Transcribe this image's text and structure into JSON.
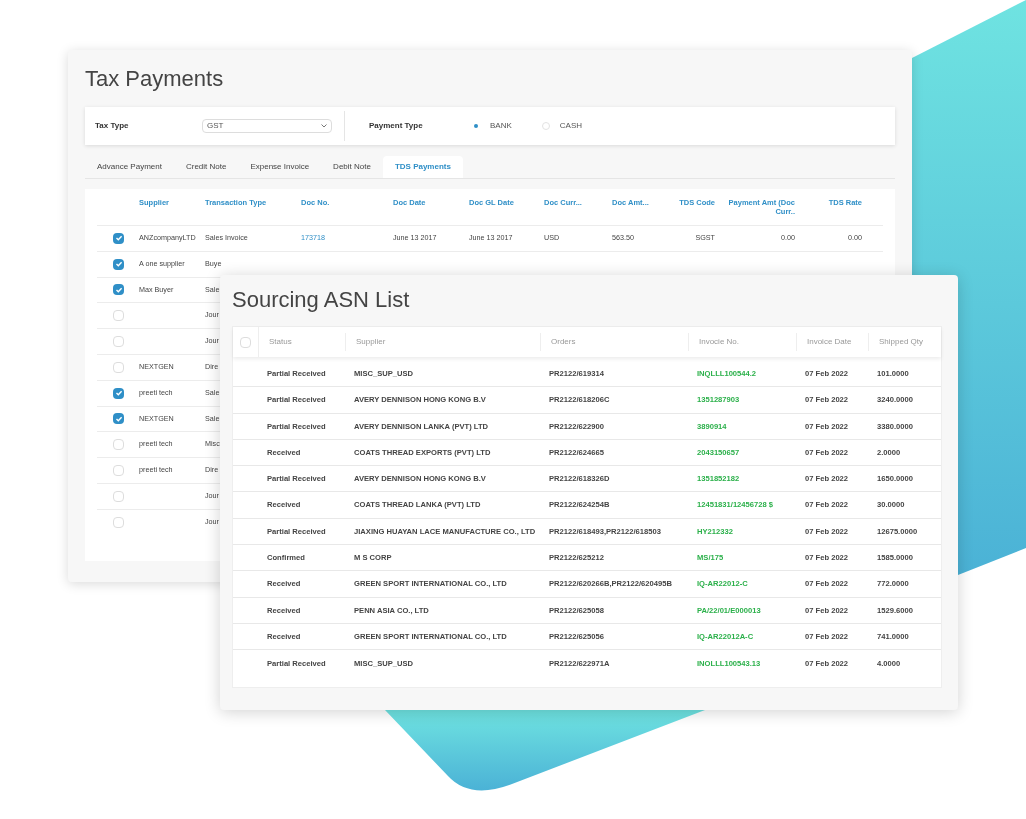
{
  "tax_payments": {
    "title": "Tax Payments",
    "tax_type": {
      "label": "Tax Type",
      "value": "GST"
    },
    "payment_type": {
      "label": "Payment Type",
      "options": [
        {
          "label": "BANK",
          "selected": true
        },
        {
          "label": "CASH",
          "selected": false
        }
      ]
    },
    "tabs": [
      {
        "label": "Advance Payment",
        "selected": false
      },
      {
        "label": "Credit Note",
        "selected": false
      },
      {
        "label": "Expense Invoice",
        "selected": false
      },
      {
        "label": "Debit Note",
        "selected": false
      },
      {
        "label": "TDS Payments",
        "selected": true
      }
    ],
    "table": {
      "columns": [
        "Supplier",
        "Transaction Type",
        "Doc No.",
        "Doc Date",
        "Doc GL Date",
        "Doc Curr...",
        "Doc Amt...",
        "TDS Code",
        "Payment Amt (Doc Curr..",
        "TDS Rate"
      ],
      "rows": [
        {
          "checked": true,
          "supplier": "ANZcompanyLTD",
          "transaction_type": "Sales Invoice",
          "doc_no": "173718",
          "doc_date": "June 13 2017",
          "doc_gl_date": "June 13 2017",
          "doc_currency": "USD",
          "doc_amount": "563.50",
          "tds_code": "SGST",
          "payment_amount": "0.00",
          "tds_rate": "0.00"
        },
        {
          "checked": true,
          "supplier": "A one supplier",
          "transaction_type": "Buye"
        },
        {
          "checked": true,
          "supplier": "Max Buyer",
          "transaction_type": "Sale"
        },
        {
          "checked": false,
          "transaction_type": "Jour"
        },
        {
          "checked": false,
          "transaction_type": "Jour"
        },
        {
          "checked": false,
          "supplier": "NEXTGEN",
          "transaction_type": "Dire"
        },
        {
          "checked": true,
          "supplier": "preeti tech",
          "transaction_type": "Sale"
        },
        {
          "checked": true,
          "supplier": "NEXTGEN",
          "transaction_type": "Sale"
        },
        {
          "checked": false,
          "supplier": "preeti tech",
          "transaction_type": "Misc"
        },
        {
          "checked": false,
          "supplier": "preeti tech",
          "transaction_type": "Dire"
        },
        {
          "checked": false,
          "transaction_type": "Jour"
        },
        {
          "checked": false,
          "transaction_type": "Jour"
        }
      ]
    }
  },
  "sourcing_asn_list": {
    "title": "Sourcing ASN List",
    "table": {
      "select_all_checked": false,
      "columns": [
        "Status",
        "Supplier",
        "Orders",
        "Invocie No.",
        "Invoice Date",
        "Shipped Qty"
      ],
      "rows": [
        {
          "status": "Partial Received",
          "supplier": "MISC_SUP_USD",
          "orders": "PR2122/619314",
          "invoice_no": "INQLLL100544.2",
          "invoice_date": "07 Feb 2022",
          "shipped_qty": "101.0000"
        },
        {
          "status": "Partial Received",
          "supplier": "AVERY DENNISON HONG KONG B.V",
          "orders": "PR2122/618206C",
          "invoice_no": "1351287903",
          "invoice_date": "07 Feb 2022",
          "shipped_qty": "3240.0000"
        },
        {
          "status": "Partial Received",
          "supplier": "AVERY DENNISON LANKA (PVT) LTD",
          "orders": "PR2122/622900",
          "invoice_no": "3890914",
          "invoice_date": "07 Feb 2022",
          "shipped_qty": "3380.0000"
        },
        {
          "status": "Received",
          "supplier": "COATS THREAD EXPORTS (PVT) LTD",
          "orders": "PR2122/624665",
          "invoice_no": "2043150657",
          "invoice_date": "07 Feb 2022",
          "shipped_qty": "2.0000"
        },
        {
          "status": "Partial Received",
          "supplier": "AVERY DENNISON HONG KONG B.V",
          "orders": "PR2122/618326D",
          "invoice_no": "1351852182",
          "invoice_date": "07 Feb 2022",
          "shipped_qty": "1650.0000"
        },
        {
          "status": "Received",
          "supplier": "COATS THREAD LANKA (PVT) LTD",
          "orders": "PR2122/624254B",
          "invoice_no": "12451831/12456728 $",
          "invoice_date": "07 Feb 2022",
          "shipped_qty": "30.0000"
        },
        {
          "status": "Partial Received",
          "supplier": "JIAXING HUAYAN LACE MANUFACTURE CO., LTD",
          "orders": "PR2122/618493,PR2122/618503",
          "invoice_no": "HY212332",
          "invoice_date": "07 Feb 2022",
          "shipped_qty": "12675.0000"
        },
        {
          "status": "Confirmed",
          "supplier": "M S CORP",
          "orders": "PR2122/625212",
          "invoice_no": "MS/175",
          "invoice_date": "07 Feb 2022",
          "shipped_qty": "1585.0000"
        },
        {
          "status": "Received",
          "supplier": "GREEN SPORT INTERNATIONAL CO., LTD",
          "orders": "PR2122/620266B,PR2122/620495B",
          "invoice_no": "IQ-AR22012-C",
          "invoice_date": "07 Feb 2022",
          "shipped_qty": "772.0000"
        },
        {
          "status": "Received",
          "supplier": "PENN ASIA CO., LTD",
          "orders": "PR2122/625058",
          "invoice_no": "PA/22/01/E000013",
          "invoice_date": "07 Feb 2022",
          "shipped_qty": "1529.6000"
        },
        {
          "status": "Received",
          "supplier": "GREEN SPORT INTERNATIONAL CO., LTD",
          "orders": "PR2122/625056",
          "invoice_no": "IQ-AR22012A-C",
          "invoice_date": "07 Feb 2022",
          "shipped_qty": "741.0000"
        },
        {
          "status": "Partial Received",
          "supplier": "MISC_SUP_USD",
          "orders": "PR2122/622971A",
          "invoice_no": "INOLLL100543.13",
          "invoice_date": "07 Feb 2022",
          "shipped_qty": "4.0000"
        }
      ]
    }
  }
}
